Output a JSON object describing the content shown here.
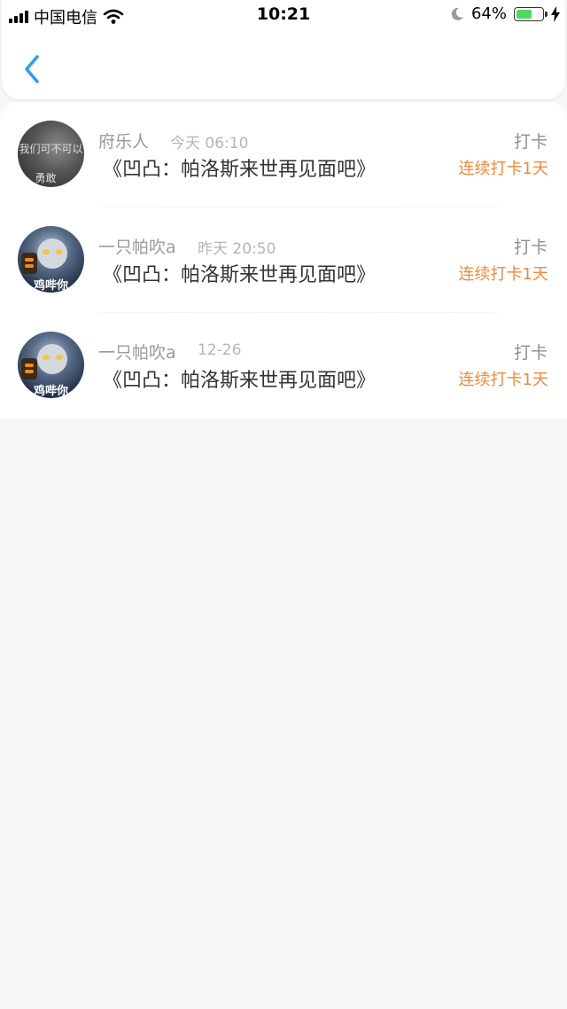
{
  "status_bar": {
    "carrier": "中国电信",
    "time": "10:21",
    "battery": "64%",
    "battery_level": 0.64,
    "wifi_icon": "wifi-icon",
    "moon_icon": "moon-icon",
    "charging_icon": "charging-icon"
  },
  "nav": {
    "back_icon": "chevron-left-icon",
    "accent": "#2c9cf0"
  },
  "items": [
    {
      "username": "府乐人",
      "time": "今天 06:10",
      "book": "《凹凸：帕洛斯来世再见面吧》",
      "tag": "打卡",
      "streak": "连续打卡1天",
      "avatar_lines": [
        "我们可不可以",
        "勇敢"
      ]
    },
    {
      "username": "一只帕吹a",
      "time": "昨天 20:50",
      "book": "《凹凸：帕洛斯来世再见面吧》",
      "tag": "打卡",
      "streak": "连续打卡1天",
      "avatar_caption": "鸡哔你"
    },
    {
      "username": "一只帕吹a",
      "time": "12-26",
      "book": "《凹凸：帕洛斯来世再见面吧》",
      "tag": "打卡",
      "streak": "连续打卡1天",
      "avatar_caption": "鸡哔你"
    }
  ],
  "colors": {
    "streak": "#f08a3c",
    "background": "#f8f6f7"
  }
}
